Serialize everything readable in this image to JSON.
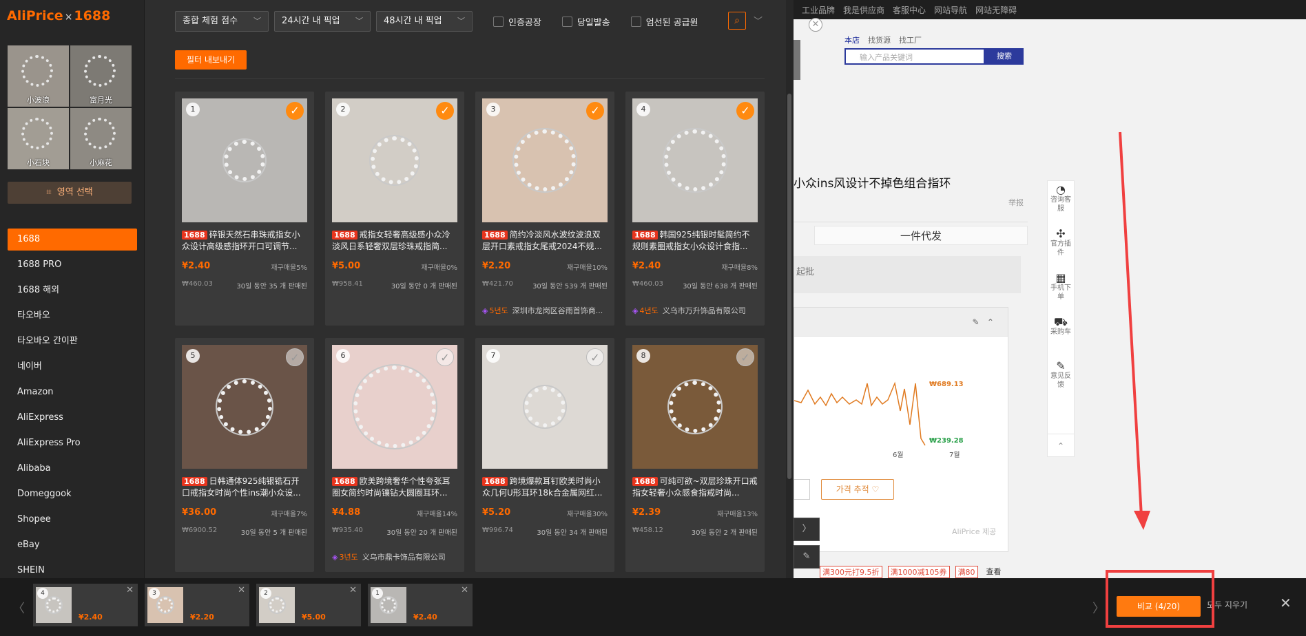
{
  "logo": {
    "brand": "AliPrice",
    "sep": "×",
    "partner": "1688"
  },
  "preview": {
    "labels": [
      "小波浪",
      "富月光",
      "小石块",
      "小麻花"
    ]
  },
  "area_select": "영역 선택",
  "sources": [
    "1688",
    "1688 PRO",
    "1688 해외",
    "타오바오",
    "타오바오 간이판",
    "네이버",
    "Amazon",
    "AliExpress",
    "AliExpress Pro",
    "Alibaba",
    "Domeggook",
    "Shopee",
    "eBay",
    "SHEIN"
  ],
  "filters": {
    "sort": "종합 체험 점수",
    "pickup24": "24시간 내 픽업",
    "pickup48": "48시간 내 픽업",
    "checks": [
      "인증공장",
      "당일발송",
      "엄선된 공급원"
    ]
  },
  "export_label": "필터 내보내기",
  "products": [
    {
      "num": "1",
      "badge": "1688",
      "title": "碎银天然石串珠戒指女小众设计高级感指环开口可调节...",
      "price": "¥2.40",
      "repurchase": "재구매율5%",
      "krw": "₩460.03",
      "sold": "30일 동안 35 개 판매된",
      "checked": true,
      "supplier": null
    },
    {
      "num": "2",
      "badge": "1688",
      "title": "戒指女轻奢高级感小众冷淡风日系轻奢双层珍珠戒指简...",
      "price": "¥5.00",
      "repurchase": "재구매율0%",
      "krw": "₩958.41",
      "sold": "30일 동안 0 개 판매된",
      "checked": true,
      "supplier": null
    },
    {
      "num": "3",
      "badge": "1688",
      "title": "简约冷淡风水波纹波浪双层开口素戒指女尾戒2024不规...",
      "price": "¥2.20",
      "repurchase": "재구매율10%",
      "krw": "₩421.70",
      "sold": "30일 동안 539 개 판매된",
      "checked": true,
      "supplier": {
        "years": "5년도",
        "name": "深圳市龙岗区谷雨首饰商..."
      }
    },
    {
      "num": "4",
      "badge": "1688",
      "title": "韩国925纯银时髦简约不规则素圈戒指女小众设计食指...",
      "price": "¥2.40",
      "repurchase": "재구매율8%",
      "krw": "₩460.03",
      "sold": "30일 동안 638 개 판매된",
      "checked": true,
      "supplier": {
        "years": "4년도",
        "name": "义乌市万升饰品有限公司"
      }
    },
    {
      "num": "5",
      "badge": "1688",
      "title": "日韩通体925纯银锆石开口戒指女时尚个性ins潮小众设...",
      "price": "¥36.00",
      "repurchase": "재구매율7%",
      "krw": "₩6900.52",
      "sold": "30일 동안 5 개 판매된",
      "checked": false,
      "supplier": null
    },
    {
      "num": "6",
      "badge": "1688",
      "title": "欧美跨境奢华个性夸张耳圈女简约时尚镶钻大圆圈耳环...",
      "price": "¥4.88",
      "repurchase": "재구매율14%",
      "krw": "₩935.40",
      "sold": "30일 동안 20 개 판매된",
      "checked": false,
      "supplier": {
        "years": "3년도",
        "name": "义乌市鼎卡饰品有限公司"
      }
    },
    {
      "num": "7",
      "badge": "1688",
      "title": "跨境爆款耳钉欧美时尚小众几何U形耳环18k合金属网红...",
      "price": "¥5.20",
      "repurchase": "재구매율30%",
      "krw": "₩996.74",
      "sold": "30일 동안 34 개 판매된",
      "checked": false,
      "supplier": null
    },
    {
      "num": "8",
      "badge": "1688",
      "title": "可纯可欲~双层珍珠开口戒指女轻奢小众感食指戒时尚...",
      "price": "¥2.39",
      "repurchase": "재구매율13%",
      "krw": "₩458.12",
      "sold": "30일 동안 2 개 판매된",
      "checked": false,
      "supplier": null
    }
  ],
  "compare_items": [
    {
      "num": "4",
      "price": "¥2.40"
    },
    {
      "num": "3",
      "price": "¥2.20"
    },
    {
      "num": "2",
      "price": "¥5.00"
    },
    {
      "num": "1",
      "price": "¥2.40"
    }
  ],
  "compare_button": "비교 (4/20)",
  "clear_all": "모두 지우기",
  "background": {
    "topnav": [
      "工业品牌",
      "我是供应商",
      "客服中心",
      "网站导航",
      "网站无障碍"
    ],
    "search_tabs": [
      "本店",
      "找货源",
      "找工厂"
    ],
    "search_placeholder": "输入产品关键词",
    "search_button": "搜索",
    "title": "小众ins风设计不掉色组合指环",
    "report": "举报",
    "tab_label": "一件代发",
    "qpi": "起批",
    "price_high": "₩689.13",
    "price_low": "₩239.28",
    "month1": "6월",
    "month2": "7월",
    "track_btn": "가격 추적 ♡",
    "aliprice": "AliPrice 제공",
    "coupons": [
      "满300元打9.5折",
      "满1000减105券",
      "满80"
    ],
    "more": "查看",
    "side": [
      "咨询客服",
      "官方插件",
      "手机下单",
      "采购车",
      "意见反馈"
    ],
    "accent": "#2c3a9c"
  },
  "colors": {
    "orange": "#ff6a00",
    "panel": "#2e2e2e",
    "red_box": "#f04040"
  }
}
